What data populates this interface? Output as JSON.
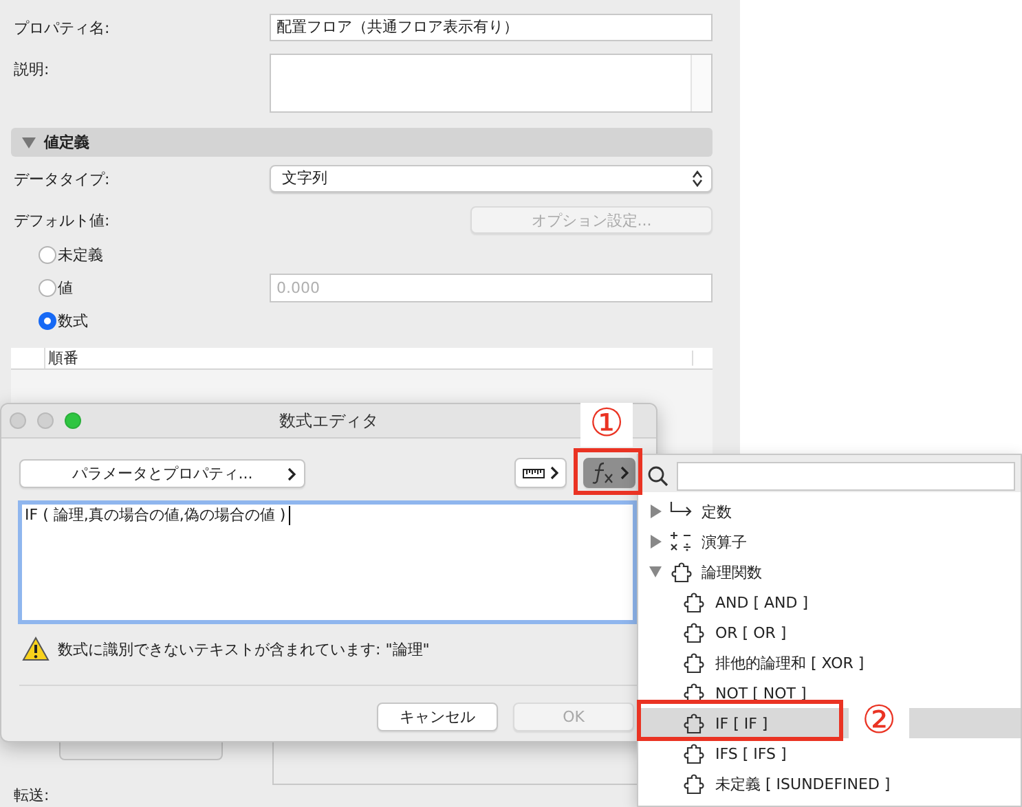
{
  "property_panel": {
    "name_label": "プロパティ名:",
    "name_value": "配置フロア（共通フロア表示有り）",
    "description_label": "説明:",
    "section": {
      "title": "値定義",
      "expanded": true
    },
    "data_type_label": "データタイプ:",
    "data_type_value": "文字列",
    "default_label": "デフォルト値:",
    "options_button": {
      "label": "オプション設定...",
      "disabled": true
    },
    "default_options": [
      {
        "label": "未定義",
        "selected": false
      },
      {
        "label": "値",
        "selected": false
      },
      {
        "label": "数式",
        "selected": true
      }
    ],
    "value_field": {
      "placeholder": "0.000"
    },
    "table": {
      "columns": [
        "順番"
      ]
    },
    "transfer_label": "転送:"
  },
  "formula_editor": {
    "title": "数式エディタ",
    "params_button": "パラメータとプロパティ...",
    "formula": "IF ( 論理,真の場合の値,偽の場合の値 )",
    "warning": "数式に識別できないテキストが含まれています: \"論理\"",
    "cancel_button": "キャンセル",
    "ok_button": {
      "label": "OK",
      "disabled": true
    }
  },
  "function_popup": {
    "tree": [
      {
        "label": "定数",
        "kind": "constants",
        "expanded": false
      },
      {
        "label": "演算子",
        "kind": "operators",
        "expanded": false
      },
      {
        "label": "論理関数",
        "kind": "functions",
        "expanded": true,
        "children": [
          {
            "label": "AND [ AND ]",
            "selected": false
          },
          {
            "label": "OR [ OR ]",
            "selected": false
          },
          {
            "label": "排他的論理和 [ XOR ]",
            "selected": false
          },
          {
            "label": "NOT [ NOT ]",
            "selected": false
          },
          {
            "label": "IF [ IF ]",
            "selected": true
          },
          {
            "label": "IFS [ IFS ]",
            "selected": false
          },
          {
            "label": "未定義 [ ISUNDEFINED ]",
            "selected": false
          }
        ]
      }
    ]
  },
  "annotations": [
    {
      "label": "①"
    },
    {
      "label": "②"
    }
  ]
}
